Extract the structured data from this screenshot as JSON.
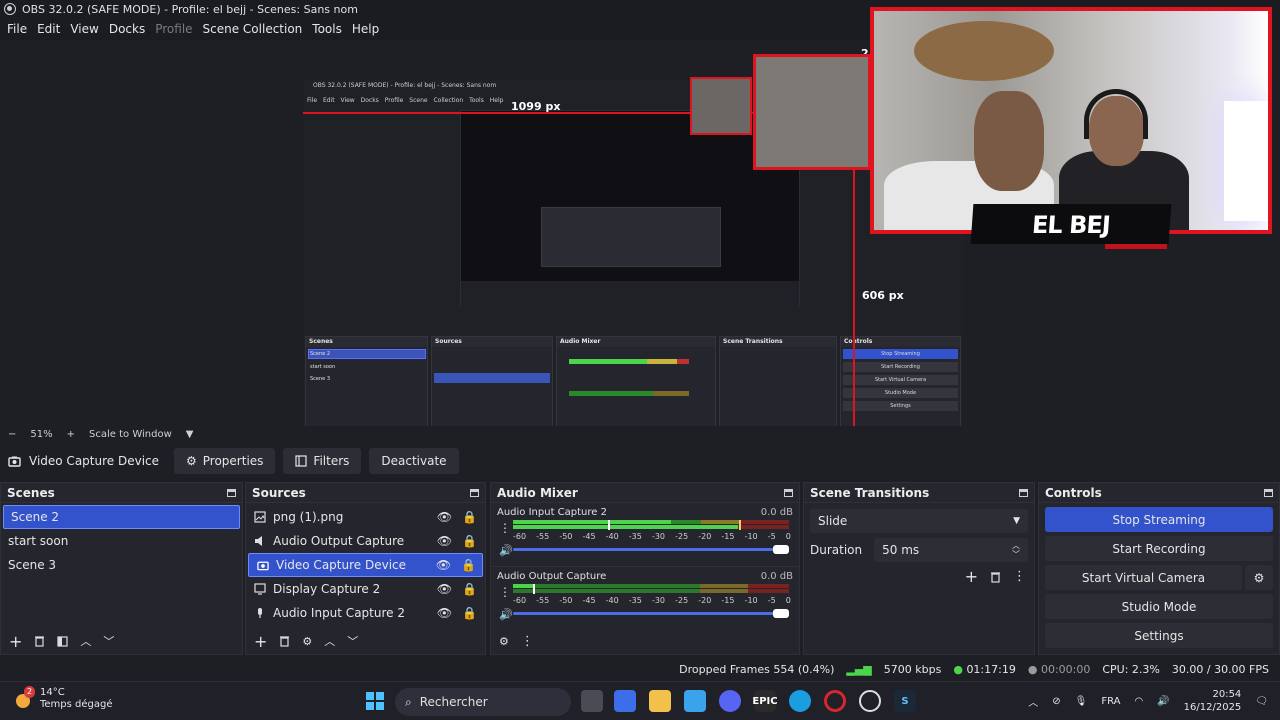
{
  "window": {
    "title": "OBS 32.0.2 (SAFE MODE) - Profile: el bejj - Scenes: Sans nom"
  },
  "menu": [
    "File",
    "Edit",
    "View",
    "Docks",
    "Profile",
    "Scene Collection",
    "Tools",
    "Help"
  ],
  "preview": {
    "measure_h": "1099 px",
    "measure_v": "606 px",
    "measure_top": "2",
    "overlay_name": "EL BEJ",
    "nested_title": "OBS 32.0.2 (SAFE MODE) - Profile: el bejj - Scenes: Sans nom",
    "nested_menu": "File Edit View Docks Profile Scene Collection Tools Help"
  },
  "zoom": {
    "minus": "−",
    "value": "51%",
    "plus": "+",
    "mode": "Scale to Window"
  },
  "context": {
    "source_name": "Video Capture Device",
    "properties": "Properties",
    "filters": "Filters",
    "deactivate": "Deactivate"
  },
  "scenes": {
    "title": "Scenes",
    "items": [
      "Scene 2",
      "start soon",
      "Scene 3"
    ],
    "selected": "Scene 2"
  },
  "sources": {
    "title": "Sources",
    "items": [
      {
        "name": "png (1).png",
        "icon": "image-icon"
      },
      {
        "name": "Audio Output Capture",
        "icon": "speaker-icon"
      },
      {
        "name": "Video Capture Device",
        "icon": "camera-icon"
      },
      {
        "name": "Display Capture 2",
        "icon": "monitor-icon"
      },
      {
        "name": "Audio Input Capture 2",
        "icon": "microphone-icon"
      }
    ]
  },
  "mixer": {
    "title": "Audio Mixer",
    "ticks": [
      "-60",
      "-55",
      "-50",
      "-45",
      "-40",
      "-35",
      "-30",
      "-25",
      "-20",
      "-15",
      "-10",
      "-5",
      "0"
    ],
    "channels": [
      {
        "name": "Audio Input Capture 2",
        "db": "0.0 dB",
        "level": 0.85
      },
      {
        "name": "Audio Output Capture",
        "db": "0.0 dB",
        "level": 0.08
      }
    ]
  },
  "transitions": {
    "title": "Scene Transitions",
    "selected": "Slide",
    "duration_label": "Duration",
    "duration_value": "50 ms"
  },
  "controls": {
    "title": "Controls",
    "stop_streaming": "Stop Streaming",
    "start_recording": "Start Recording",
    "start_virtual_camera": "Start Virtual Camera",
    "studio_mode": "Studio Mode",
    "settings": "Settings"
  },
  "status": {
    "dropped_frames": "Dropped Frames 554 (0.4%)",
    "bitrate": "5700 kbps",
    "stream_time": "01:17:19",
    "rec_time": "00:00:00",
    "cpu": "CPU: 2.3%",
    "fps": "30.00 / 30.00 FPS"
  },
  "taskbar": {
    "weather_temp": "14°C",
    "weather_desc": "Temps dégagé",
    "weather_badge": "2",
    "search": "Rechercher",
    "language": "FRA",
    "time": "20:54",
    "date": "16/12/2025"
  },
  "colors": {
    "accent": "#3353cc",
    "overlay_red": "#e0141e",
    "meter_green": "#4cd44c",
    "meter_yellow": "#c8b43c",
    "meter_red": "#c03030"
  }
}
